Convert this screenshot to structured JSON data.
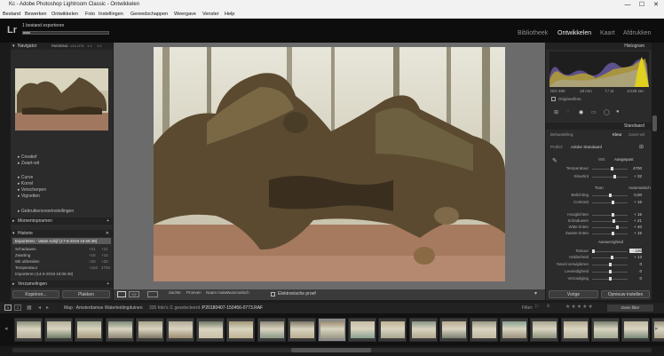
{
  "window": {
    "title": "Kc - Adobe Photoshop Lightroom Classic - Ontwikkelen",
    "controls": [
      "—",
      "☐",
      "✕"
    ]
  },
  "menu": [
    "Bestand",
    "Bewerken",
    "Ontwikkelen",
    "Foto",
    "Instellingen",
    "Gereedschappen",
    "Weergave",
    "Venster",
    "Help"
  ],
  "identity": {
    "logo": "Lr",
    "task": "1 bestand exporteren",
    "task_progress_fraction": 0.08
  },
  "modules": [
    "Bibliotheek",
    "Ontwikkelen",
    "Kaart",
    "Afdrukken"
  ],
  "active_module": "Ontwikkelen",
  "left": {
    "navigator": {
      "title": "Navigator",
      "zoom_options": [
        "PASSEND",
        "VULLEN",
        "1:1",
        "1:2"
      ]
    },
    "presets": [
      "Creatief",
      "Zwart-wit",
      "Curve",
      "Korrel",
      "Verscherpen",
      "Vignetten",
      "Gebruikersvoorinstellingen"
    ],
    "snapshots_title": "Momentopnamen",
    "history_title": "Historie",
    "history": [
      {
        "label": "Exporteren - Vaste schijf (17-6-2019 15:58:38)",
        "a": "",
        "b": ""
      },
      {
        "label": "Schaduwen",
        "a": "+21",
        "b": "+21"
      },
      {
        "label": "Zwarting",
        "a": "+15",
        "b": "+15"
      },
      {
        "label": "Wit uitbreiden",
        "a": "+20",
        "b": "+20"
      },
      {
        "label": "Temperatuur",
        "a": "+162",
        "b": "4700"
      },
      {
        "label": "Importeren (14-6-2019 19:06:49)",
        "a": "",
        "b": ""
      }
    ],
    "collections_title": "Verzamelingen",
    "copy_button": "Kopiëren...",
    "paste_button": "Plakken"
  },
  "right": {
    "histogram_title": "Histogram",
    "histogram_info": [
      "ISO 250",
      "18 mm",
      "f / 11",
      "1/125 sec"
    ],
    "original_photo": "Origineelfoto",
    "profile_row": "Standaard",
    "treatment_label": "Behandeling:",
    "treatment_options": [
      "Kleur",
      "Zwart-wit"
    ],
    "profile_label": "Profiel:",
    "profile_value": "Adobe Standaard",
    "wb_label": "WB:",
    "wb_value": "Aangepast",
    "tone_label": "Toon",
    "tone_auto": "Automatisch",
    "presence_label": "Aanwezigheid",
    "sliders": [
      {
        "label": "Temperatuur",
        "value": "4700",
        "pos": 0.55
      },
      {
        "label": "Kleurtint",
        "value": "+ 32",
        "pos": 0.62
      },
      {
        "label": "Belichting",
        "value": "0,00",
        "pos": 0.5
      },
      {
        "label": "Contrast",
        "value": "+ 16",
        "pos": 0.58
      },
      {
        "label": "Hooglichten",
        "value": "+ 15",
        "pos": 0.57
      },
      {
        "label": "Schaduwen",
        "value": "+ 21",
        "pos": 0.6
      },
      {
        "label": "Witte tinten",
        "value": "+ 40",
        "pos": 0.7
      },
      {
        "label": "Zwarte tinten",
        "value": "+ 15",
        "pos": 0.57
      },
      {
        "label": "Textuur",
        "value": "- 100",
        "pos": 0.0
      },
      {
        "label": "Helderheid",
        "value": "+ 13",
        "pos": 0.56
      },
      {
        "label": "Nevel verwijderen",
        "value": "0",
        "pos": 0.5
      },
      {
        "label": "Levendigheid",
        "value": "0",
        "pos": 0.5
      },
      {
        "label": "Verzadiging",
        "value": "0",
        "pos": 0.5
      }
    ],
    "previous_button": "Vorige",
    "reset_button": "Opnieuw instellen"
  },
  "toolbar": {
    "labels": [
      "Zachte",
      "Proeven",
      "Naam maken",
      "Automatisch"
    ],
    "softproof": "Elektronische proef"
  },
  "filmbar": {
    "pages": [
      "1",
      "2"
    ],
    "path": "Map : Amsterdamse Waterleidingduinen",
    "count": "335 foto's /1 geselecteerd /",
    "filename": "P20180407-150456-0773.RAF",
    "filter_label": "Filter:",
    "filter_value": "Geen filter"
  },
  "colors": {
    "accent": "#d8d8d8",
    "panel_bg": "#2b2b2b",
    "center_bg": "#6b6b6b"
  }
}
